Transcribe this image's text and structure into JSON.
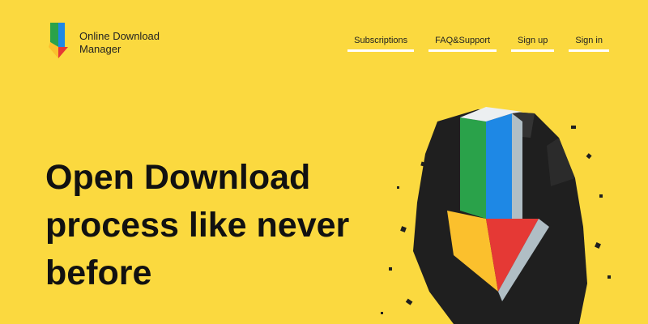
{
  "header": {
    "brand_line1": "Online Download",
    "brand_line2": "Manager",
    "logo_icon": "download-arrow-logo-icon"
  },
  "nav": {
    "items": [
      {
        "label": "Subscriptions"
      },
      {
        "label": "FAQ&Support"
      },
      {
        "label": "Sign up"
      },
      {
        "label": "Sign in"
      }
    ]
  },
  "hero": {
    "line1": "Open Download",
    "line2": "process like never",
    "line3": "before"
  },
  "colors": {
    "background": "#fbd93f",
    "green": "#2aa24a",
    "blue": "#1e88e5",
    "red": "#e53935",
    "yellow": "#fbc02d"
  }
}
